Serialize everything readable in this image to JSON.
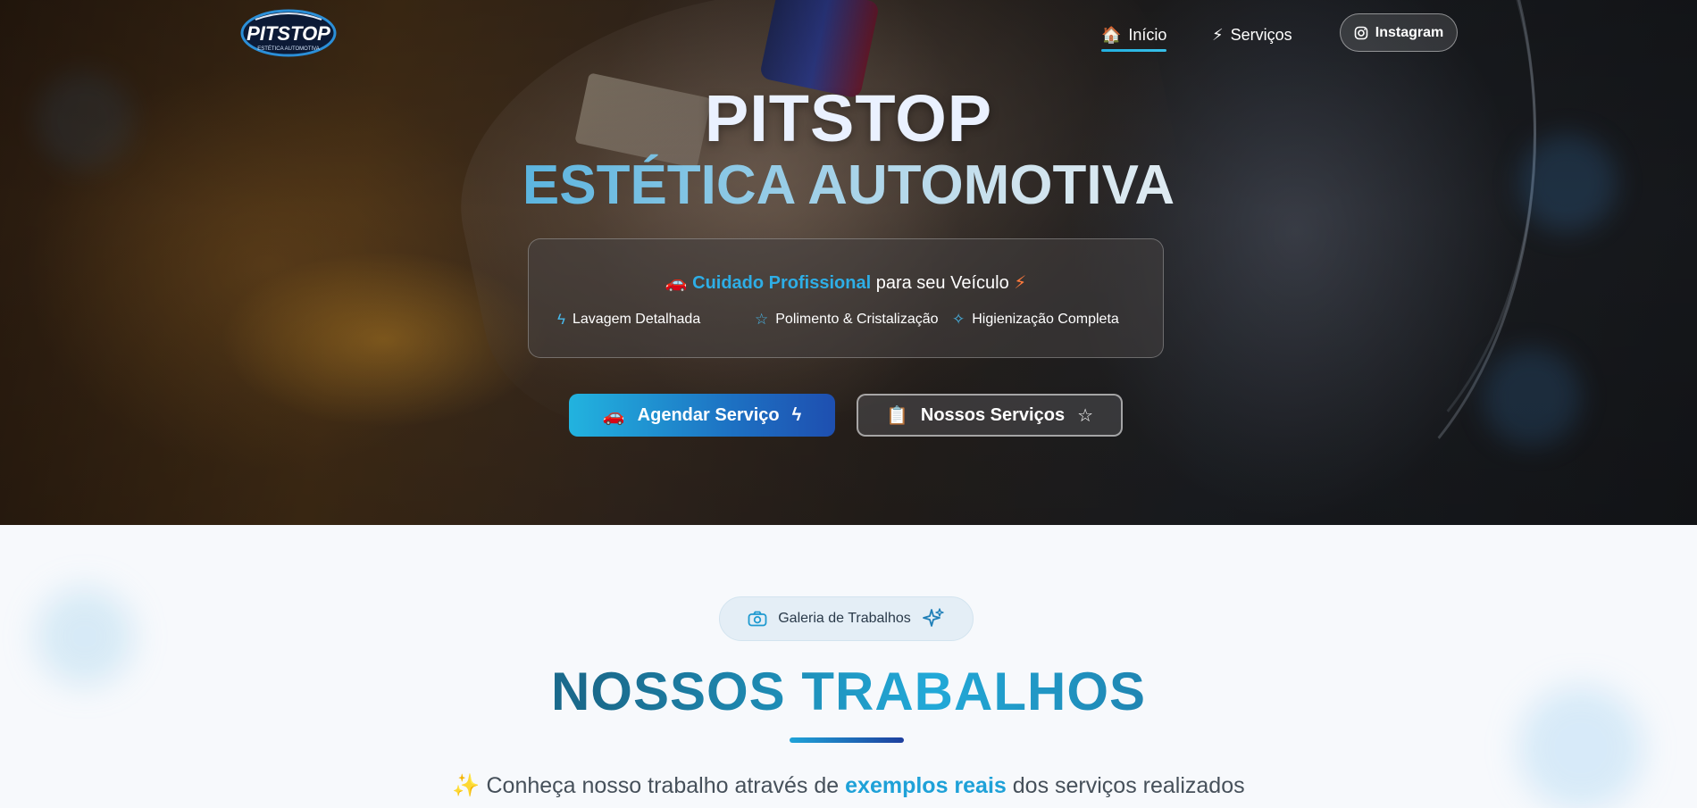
{
  "brand": {
    "logo_text": "PITSTOP",
    "logo_subtext": "ESTÉTICA AUTOMOTIVA"
  },
  "nav": {
    "home": {
      "icon": "🏠",
      "label": "Início"
    },
    "services": {
      "icon": "⚡",
      "label": "Serviços"
    },
    "instagram": {
      "label": "Instagram"
    }
  },
  "hero": {
    "title_line1": "PITSTOP",
    "title_line2": "ESTÉTICA AUTOMOTIVA",
    "tagline": {
      "icon_start": "🚗",
      "highlight": "Cuidado Profissional",
      "rest": "para seu Veículo",
      "icon_end": "⚡"
    },
    "features": [
      {
        "icon": "ϟ",
        "label": "Lavagem Detalhada"
      },
      {
        "icon": "☆",
        "label": "Polimento & Cristalização"
      },
      {
        "icon": "✧",
        "label": "Higienização Completa"
      }
    ],
    "cta_primary": {
      "icon": "🚗",
      "label": "Agendar Serviço",
      "icon_end": "ϟ"
    },
    "cta_secondary": {
      "icon": "📋",
      "label": "Nossos Serviços",
      "icon_end": "☆"
    }
  },
  "gallery": {
    "pill_label": "Galeria de Trabalhos",
    "title": "NOSSOS TRABALHOS",
    "desc_icon": "✨",
    "desc_before": "Conheça nosso trabalho através de",
    "desc_highlight": "exemplos reais",
    "desc_after": "dos serviços realizados"
  },
  "colors": {
    "accent": "#22b0e0",
    "accent_dark": "#1e4fb0",
    "bolt": "#ff7a3c"
  }
}
